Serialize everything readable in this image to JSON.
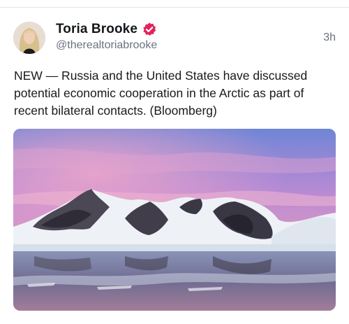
{
  "tweet": {
    "author": {
      "display_name": "Toria Brooke",
      "handle": "@therealtoriabrooke",
      "verified": true,
      "verified_badge_color": "#e0245e"
    },
    "timestamp": "3h",
    "text": "NEW — Russia and the United States have discussed potential economic cooperation in the Arctic as part of recent bilateral contacts. (Bloomberg)",
    "media": {
      "icon": "photo-arctic-mountains-pink-sky"
    }
  },
  "colors": {
    "text_primary": "#14171a",
    "text_secondary": "#6b7280",
    "divider": "#e6e6e6"
  }
}
